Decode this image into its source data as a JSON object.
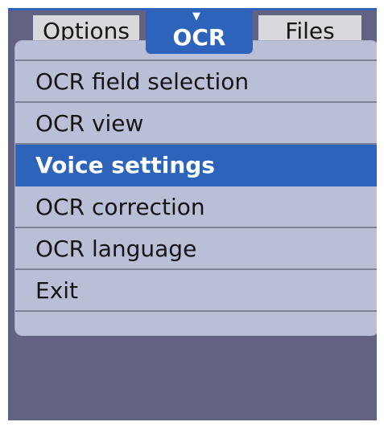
{
  "tabs": {
    "left_label": "Options",
    "active_label": "OCR",
    "active_caret_icon": "caret-down-icon",
    "right_label": "Files"
  },
  "menu": {
    "items": [
      {
        "label": "OCR field selection",
        "selected": false
      },
      {
        "label": "OCR view",
        "selected": false
      },
      {
        "label": "Voice settings",
        "selected": true
      },
      {
        "label": "OCR correction",
        "selected": false
      },
      {
        "label": "OCR language",
        "selected": false
      },
      {
        "label": "Exit",
        "selected": false
      }
    ]
  },
  "colors": {
    "accent": "#2d63bb",
    "background": "#626283",
    "menu_background": "#b9bfd6",
    "tab_background": "#d8d8dd",
    "text": "#151515",
    "divider": "#7c8197"
  }
}
